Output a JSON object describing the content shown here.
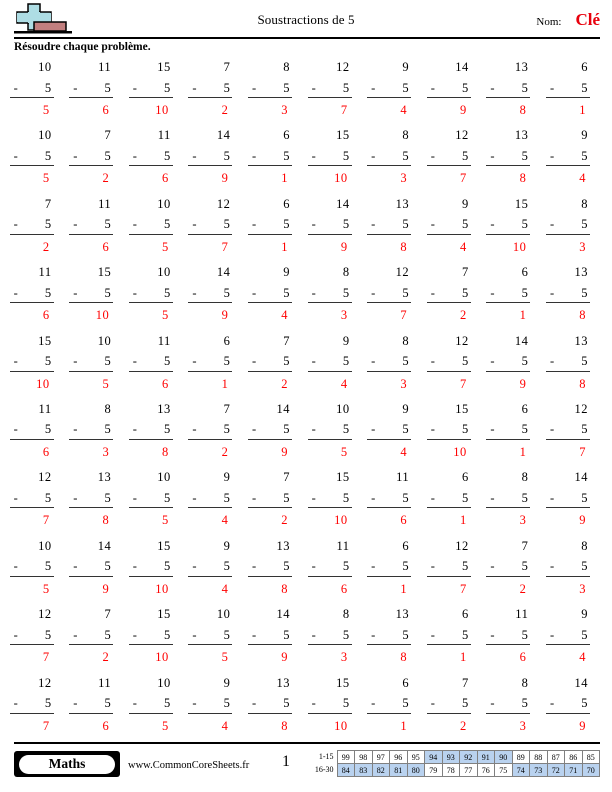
{
  "header": {
    "logo_icon": "plus-and-bar-logo",
    "title": "Soustractions de 5",
    "name_label": "Nom:",
    "name_value": "Clé",
    "name_value_color": "#e8000d",
    "instructions": "Résoudre chaque problème."
  },
  "worksheet": {
    "operator": "-",
    "subtrahend": "5",
    "answer_color": "#ff0000",
    "rows": [
      {
        "minuends": [
          "10",
          "11",
          "15",
          "7",
          "8",
          "12",
          "9",
          "14",
          "13",
          "6"
        ],
        "answers": [
          "5",
          "6",
          "10",
          "2",
          "3",
          "7",
          "4",
          "9",
          "8",
          "1"
        ]
      },
      {
        "minuends": [
          "10",
          "7",
          "11",
          "14",
          "6",
          "15",
          "8",
          "12",
          "13",
          "9"
        ],
        "answers": [
          "5",
          "2",
          "6",
          "9",
          "1",
          "10",
          "3",
          "7",
          "8",
          "4"
        ]
      },
      {
        "minuends": [
          "7",
          "11",
          "10",
          "12",
          "6",
          "14",
          "13",
          "9",
          "15",
          "8"
        ],
        "answers": [
          "2",
          "6",
          "5",
          "7",
          "1",
          "9",
          "8",
          "4",
          "10",
          "3"
        ]
      },
      {
        "minuends": [
          "11",
          "15",
          "10",
          "14",
          "9",
          "8",
          "12",
          "7",
          "6",
          "13"
        ],
        "answers": [
          "6",
          "10",
          "5",
          "9",
          "4",
          "3",
          "7",
          "2",
          "1",
          "8"
        ]
      },
      {
        "minuends": [
          "15",
          "10",
          "11",
          "6",
          "7",
          "9",
          "8",
          "12",
          "14",
          "13"
        ],
        "answers": [
          "10",
          "5",
          "6",
          "1",
          "2",
          "4",
          "3",
          "7",
          "9",
          "8"
        ]
      },
      {
        "minuends": [
          "11",
          "8",
          "13",
          "7",
          "14",
          "10",
          "9",
          "15",
          "6",
          "12"
        ],
        "answers": [
          "6",
          "3",
          "8",
          "2",
          "9",
          "5",
          "4",
          "10",
          "1",
          "7"
        ]
      },
      {
        "minuends": [
          "12",
          "13",
          "10",
          "9",
          "7",
          "15",
          "11",
          "6",
          "8",
          "14"
        ],
        "answers": [
          "7",
          "8",
          "5",
          "4",
          "2",
          "10",
          "6",
          "1",
          "3",
          "9"
        ]
      },
      {
        "minuends": [
          "10",
          "14",
          "15",
          "9",
          "13",
          "11",
          "6",
          "12",
          "7",
          "8"
        ],
        "answers": [
          "5",
          "9",
          "10",
          "4",
          "8",
          "6",
          "1",
          "7",
          "2",
          "3"
        ]
      },
      {
        "minuends": [
          "12",
          "7",
          "15",
          "10",
          "14",
          "8",
          "13",
          "6",
          "11",
          "9"
        ],
        "answers": [
          "7",
          "2",
          "10",
          "5",
          "9",
          "3",
          "8",
          "1",
          "6",
          "4"
        ]
      },
      {
        "minuends": [
          "12",
          "11",
          "10",
          "9",
          "13",
          "15",
          "6",
          "7",
          "8",
          "14"
        ],
        "answers": [
          "7",
          "6",
          "5",
          "4",
          "8",
          "10",
          "1",
          "2",
          "3",
          "9"
        ]
      }
    ]
  },
  "footer": {
    "brand": "Maths",
    "site": "www.CommonCoreSheets.fr",
    "page_number": "1",
    "score_table": {
      "highlight_color": "#b9d2ef",
      "rows": [
        {
          "label": "1-15",
          "cells": [
            {
              "value": "99",
              "highlighted": false
            },
            {
              "value": "98",
              "highlighted": false
            },
            {
              "value": "97",
              "highlighted": false
            },
            {
              "value": "96",
              "highlighted": false
            },
            {
              "value": "95",
              "highlighted": false
            },
            {
              "value": "94",
              "highlighted": true
            },
            {
              "value": "93",
              "highlighted": true
            },
            {
              "value": "92",
              "highlighted": true
            },
            {
              "value": "91",
              "highlighted": true
            },
            {
              "value": "90",
              "highlighted": true
            },
            {
              "value": "89",
              "highlighted": false
            },
            {
              "value": "88",
              "highlighted": false
            },
            {
              "value": "87",
              "highlighted": false
            },
            {
              "value": "86",
              "highlighted": false
            },
            {
              "value": "85",
              "highlighted": false
            }
          ]
        },
        {
          "label": "16-30",
          "cells": [
            {
              "value": "84",
              "highlighted": true
            },
            {
              "value": "83",
              "highlighted": true
            },
            {
              "value": "82",
              "highlighted": true
            },
            {
              "value": "81",
              "highlighted": true
            },
            {
              "value": "80",
              "highlighted": true
            },
            {
              "value": "79",
              "highlighted": false
            },
            {
              "value": "78",
              "highlighted": false
            },
            {
              "value": "77",
              "highlighted": false
            },
            {
              "value": "76",
              "highlighted": false
            },
            {
              "value": "75",
              "highlighted": false
            },
            {
              "value": "74",
              "highlighted": true
            },
            {
              "value": "73",
              "highlighted": true
            },
            {
              "value": "72",
              "highlighted": true
            },
            {
              "value": "71",
              "highlighted": true
            },
            {
              "value": "70",
              "highlighted": true
            }
          ]
        }
      ]
    }
  }
}
